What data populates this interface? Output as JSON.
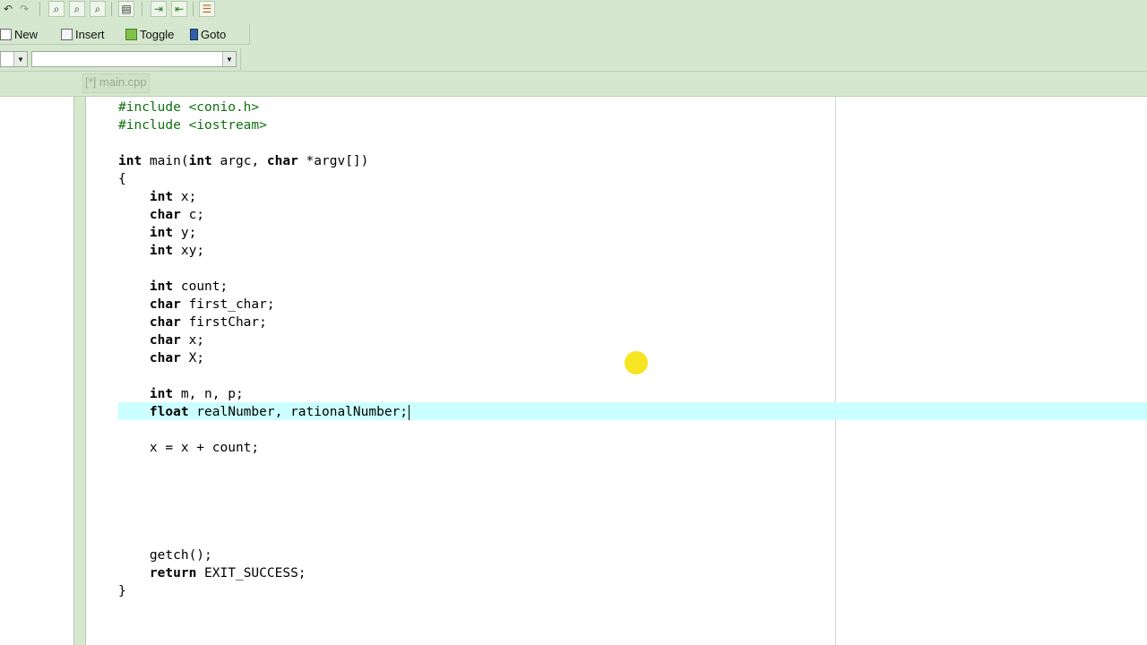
{
  "toolbar": {
    "new_label": "New",
    "insert_label": "Insert",
    "toggle_label": "Toggle",
    "goto_label": "Goto"
  },
  "tab": {
    "label": "[*] main.cpp"
  },
  "code": [
    {
      "parts": [
        {
          "t": "#include <conio.h>",
          "c": "pp"
        }
      ]
    },
    {
      "parts": [
        {
          "t": "#include <iostream>",
          "c": "pp"
        }
      ]
    },
    {
      "parts": []
    },
    {
      "parts": [
        {
          "t": "int",
          "c": "kw"
        },
        {
          "t": " main("
        },
        {
          "t": "int",
          "c": "kw"
        },
        {
          "t": " argc, "
        },
        {
          "t": "char",
          "c": "kw"
        },
        {
          "t": " *argv[])"
        }
      ]
    },
    {
      "parts": [
        {
          "t": "{"
        }
      ]
    },
    {
      "parts": [
        {
          "t": "    "
        },
        {
          "t": "int",
          "c": "kw"
        },
        {
          "t": " x;"
        }
      ]
    },
    {
      "parts": [
        {
          "t": "    "
        },
        {
          "t": "char",
          "c": "kw"
        },
        {
          "t": " c;"
        }
      ]
    },
    {
      "parts": [
        {
          "t": "    "
        },
        {
          "t": "int",
          "c": "kw"
        },
        {
          "t": " y;"
        }
      ]
    },
    {
      "parts": [
        {
          "t": "    "
        },
        {
          "t": "int",
          "c": "kw"
        },
        {
          "t": " xy;"
        }
      ]
    },
    {
      "parts": []
    },
    {
      "parts": [
        {
          "t": "    "
        },
        {
          "t": "int",
          "c": "kw"
        },
        {
          "t": " count;"
        }
      ]
    },
    {
      "parts": [
        {
          "t": "    "
        },
        {
          "t": "char",
          "c": "kw"
        },
        {
          "t": " first_char;"
        }
      ]
    },
    {
      "parts": [
        {
          "t": "    "
        },
        {
          "t": "char",
          "c": "kw"
        },
        {
          "t": " firstChar;"
        }
      ]
    },
    {
      "parts": [
        {
          "t": "    "
        },
        {
          "t": "char",
          "c": "kw"
        },
        {
          "t": " x;"
        }
      ]
    },
    {
      "parts": [
        {
          "t": "    "
        },
        {
          "t": "char",
          "c": "kw"
        },
        {
          "t": " X;"
        }
      ]
    },
    {
      "parts": []
    },
    {
      "parts": [
        {
          "t": "    "
        },
        {
          "t": "int",
          "c": "kw"
        },
        {
          "t": " m, n, p;"
        }
      ]
    },
    {
      "parts": [
        {
          "t": "    "
        },
        {
          "t": "float",
          "c": "kw"
        },
        {
          "t": " realNumber, rationalNumber;"
        }
      ],
      "current": true
    },
    {
      "parts": []
    },
    {
      "parts": [
        {
          "t": "    x = x + count;"
        }
      ]
    },
    {
      "parts": []
    },
    {
      "parts": []
    },
    {
      "parts": []
    },
    {
      "parts": []
    },
    {
      "parts": []
    },
    {
      "parts": [
        {
          "t": "    getch();"
        }
      ]
    },
    {
      "parts": [
        {
          "t": "    "
        },
        {
          "t": "return",
          "c": "kw"
        },
        {
          "t": " EXIT_SUCCESS;"
        }
      ]
    },
    {
      "parts": [
        {
          "t": "}"
        }
      ]
    }
  ]
}
